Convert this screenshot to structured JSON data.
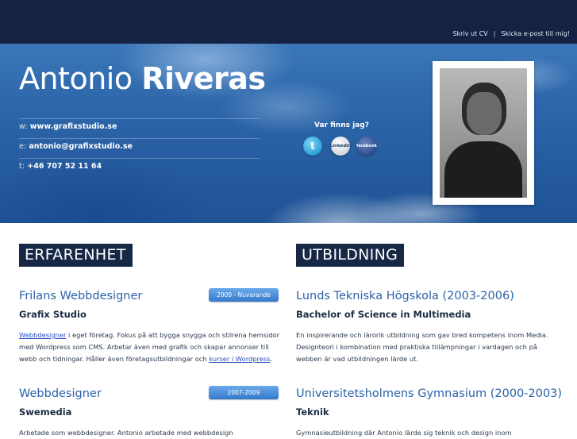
{
  "header": {
    "links": {
      "print_cv": "Skriv ut CV",
      "separator": "|",
      "email_me": "Skicka e-post till mig!"
    }
  },
  "hero": {
    "first_name": "Antonio",
    "last_name": "Riveras",
    "contact": [
      {
        "key": "w:",
        "value": "www.grafixstudio.se"
      },
      {
        "key": "e:",
        "value": "antonio@grafixstudio.se"
      },
      {
        "key": "t:",
        "value": "+46 707 52 11 64"
      }
    ],
    "social": {
      "heading": "Var finns jag?",
      "twitter": "t",
      "linkedin": "LinkedIn",
      "facebook": "facebook"
    }
  },
  "experience": {
    "title": "ERFARENHET",
    "items": [
      {
        "title": "Frilans Webbdesigner",
        "period": "2009 - Nuvarande",
        "company": "Grafix Studio",
        "desc_link1": "Webbdesigner",
        "desc_part1": " i eget företag. Fokus på att bygga snygga och stilrena hemsidor med Wordpress som CMS. Arbetar även med grafik och skapar annonser till webb och tidningar. Håller även företagsutbildningar och ",
        "desc_link2": "kurser i Wordpress",
        "desc_part2": "."
      },
      {
        "title": "Webbdesigner",
        "period": "2007-2009",
        "company": "Swemedia",
        "desc": "Arbetade som webbdesigner. Antonio arbetade med webbdesign"
      }
    ]
  },
  "education": {
    "title": "UTBILDNING",
    "items": [
      {
        "title": "Lunds Tekniska Högskola (2003-2006)",
        "degree": "Bachelor of Science in Multimedia",
        "desc": "En inspirerande och lärorik utbildning som gav bred kompetens inom Media. Designteori i kombination med praktiska tillämpningar i vardagen och på webben är vad utbildningen lärde ut."
      },
      {
        "title": "Universitetsholmens Gymnasium (2000-2003)",
        "degree": "Teknik",
        "desc": "Gymnasieutbildning där Antonio lärde sig teknik och design inom"
      }
    ]
  },
  "colors": {
    "topbar": "#142343",
    "section_title_bg": "#172846",
    "accent_blue": "#2b62a8",
    "badge_blue": "#3579cb"
  }
}
